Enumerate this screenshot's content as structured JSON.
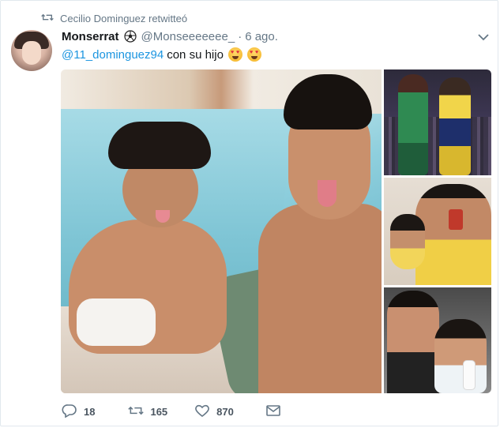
{
  "context": {
    "label": "Cecilio Dominguez retwitteó",
    "icon": "retweet-icon"
  },
  "author": {
    "name": "Monserrat",
    "badge_icon": "soccer-ball-icon",
    "handle": "@Monseeeeeee_",
    "separator": "·",
    "time": "6 ago."
  },
  "tweet": {
    "mention": "@11_dominguez94",
    "text": "con su hijo",
    "emoji": "heart-eyes-emoji"
  },
  "menu_icon": "chevron-down-icon",
  "media": {
    "photos": [
      "main-photo",
      "players-photo",
      "yellow-shirt-photo",
      "selfie-photo"
    ]
  },
  "actions": {
    "reply": {
      "icon": "reply-icon",
      "count": "18"
    },
    "retweet": {
      "icon": "retweet-icon",
      "count": "165"
    },
    "like": {
      "icon": "heart-icon",
      "count": "870"
    },
    "dm": {
      "icon": "envelope-icon"
    }
  },
  "colors": {
    "link": "#1b95e0",
    "muted": "#657786",
    "text": "#14171a",
    "border": "#e1e8ed"
  }
}
